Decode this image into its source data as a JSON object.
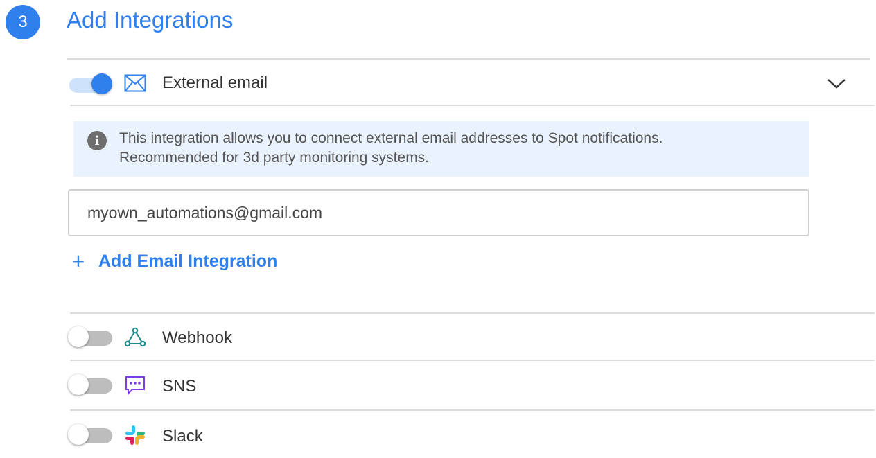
{
  "section": {
    "step_number": "3",
    "title": "Add Integrations"
  },
  "integrations": [
    {
      "label": "External email",
      "enabled": true,
      "icon": "envelope-icon",
      "expanded": true
    },
    {
      "label": "Webhook",
      "enabled": false,
      "icon": "webhook-icon"
    },
    {
      "label": "SNS",
      "enabled": false,
      "icon": "chat-bubble-icon"
    },
    {
      "label": "Slack",
      "enabled": false,
      "icon": "slack-icon"
    }
  ],
  "email_panel": {
    "info_line1": "This integration allows you to connect external email addresses to Spot notifications.",
    "info_line2": "Recommended for 3d party monitoring systems.",
    "email_value": "myown_automations@gmail.com",
    "add_label": "Add Email Integration"
  },
  "colors": {
    "accent": "#2f80ed",
    "info_bg": "#eaf2fd",
    "toggle_off": "#bdbdbd",
    "webhook": "#1e8a8a",
    "sns": "#7b3fe4"
  }
}
